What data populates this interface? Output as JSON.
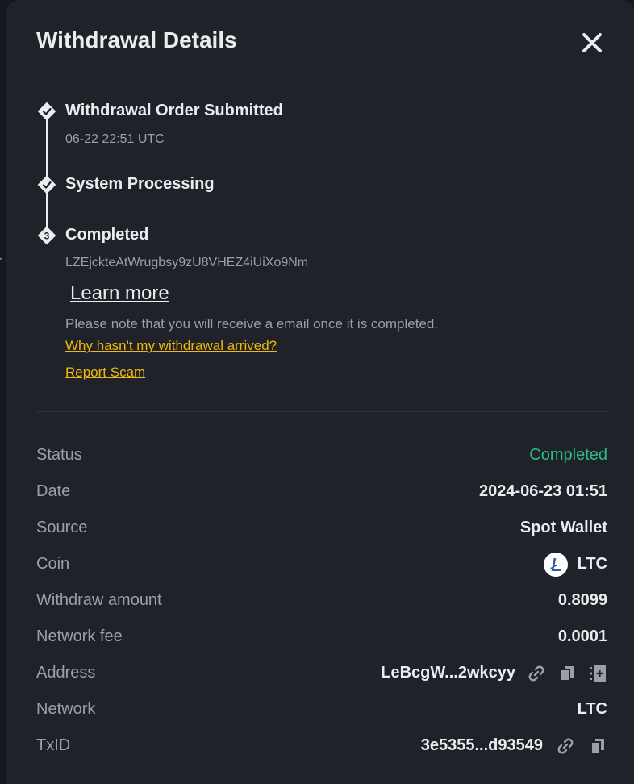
{
  "background": {
    "stray_text": "r"
  },
  "header": {
    "title": "Withdrawal Details"
  },
  "timeline": {
    "steps": [
      {
        "title": "Withdrawal Order Submitted",
        "subtitle": "06-22 22:51 UTC",
        "marker": "check"
      },
      {
        "title": "System Processing",
        "marker": "check"
      },
      {
        "title": "Completed",
        "subtitle": "LZEjckteAtWrugbsy9zU8VHEZ4iUiXo9Nm",
        "marker": "3"
      }
    ],
    "learn_more": "Learn more",
    "note": "Please note that you will receive a email once it is completed.",
    "why_link": "Why hasn't my withdrawal arrived?",
    "report_link": "Report Scam"
  },
  "details": {
    "status": {
      "label": "Status",
      "value": "Completed"
    },
    "date": {
      "label": "Date",
      "value": "2024-06-23 01:51"
    },
    "source": {
      "label": "Source",
      "value": "Spot Wallet"
    },
    "coin": {
      "label": "Coin",
      "value": "LTC",
      "icon": "litecoin-icon"
    },
    "withdraw_amount": {
      "label": "Withdraw amount",
      "value": "0.8099"
    },
    "network_fee": {
      "label": "Network fee",
      "value": "0.0001"
    },
    "address": {
      "label": "Address",
      "value": "LeBcgW...2wkcyy"
    },
    "network": {
      "label": "Network",
      "value": "LTC"
    },
    "txid": {
      "label": "TxID",
      "value": "3e5355...d93549"
    }
  },
  "colors": {
    "modal_bg": "#1f2228",
    "text_primary": "#eaecef",
    "text_secondary": "#9aa0aa",
    "accent_yellow": "#f0b90b",
    "status_green": "#2ebd85"
  }
}
